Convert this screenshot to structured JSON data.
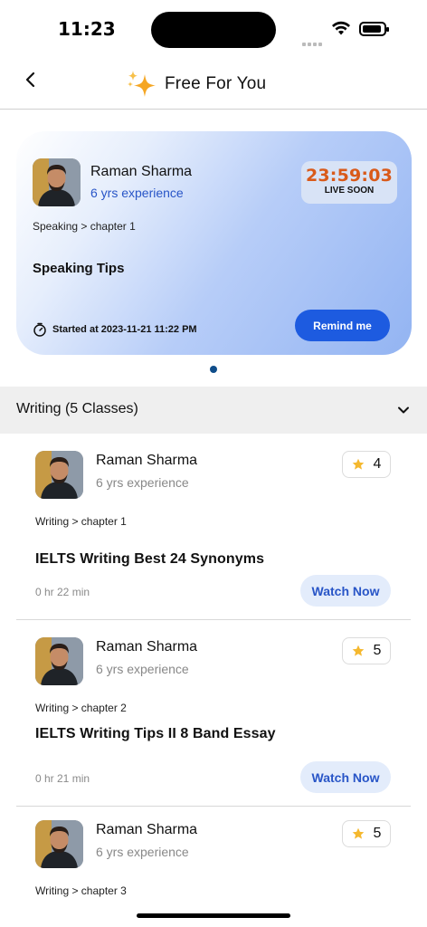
{
  "status_bar": {
    "time": "11:23"
  },
  "header": {
    "title": "Free For You"
  },
  "featured": {
    "teacher_name": "Raman Sharma",
    "experience": "6 yrs experience",
    "countdown": "23:59:03",
    "status": "LIVE SOON",
    "breadcrumb": "Speaking > chapter 1",
    "class_title": "Speaking Tips",
    "started_at": "Started at 2023-11-21  11:22 PM",
    "remind_label": "Remind me"
  },
  "section": {
    "title": "Writing (5 Classes)"
  },
  "classes": [
    {
      "teacher_name": "Raman Sharma",
      "experience": "6 yrs experience",
      "rating": "4",
      "breadcrumb": "Writing > chapter 1",
      "title": "IELTS Writing Best 24 Synonyms",
      "duration": "0 hr 22 min",
      "watch_label": "Watch Now"
    },
    {
      "teacher_name": "Raman Sharma",
      "experience": "6 yrs experience",
      "rating": "5",
      "breadcrumb": "Writing > chapter 2",
      "title": "IELTS Writing Tips II 8 Band Essay",
      "duration": "0 hr 21 min",
      "watch_label": "Watch Now"
    },
    {
      "teacher_name": "Raman Sharma",
      "experience": "6 yrs experience",
      "rating": "5",
      "breadcrumb": "Writing > chapter 3"
    }
  ],
  "colors": {
    "accent": "#1d5be0",
    "experience_blue": "#2855c7",
    "countdown": "#d95a1a",
    "star": "#f5b82e"
  },
  "icons": {
    "back": "chevron-left-icon",
    "title": "sparkle-icon",
    "started": "stopwatch-icon",
    "rating": "star-icon",
    "section": "chevron-down-icon"
  }
}
